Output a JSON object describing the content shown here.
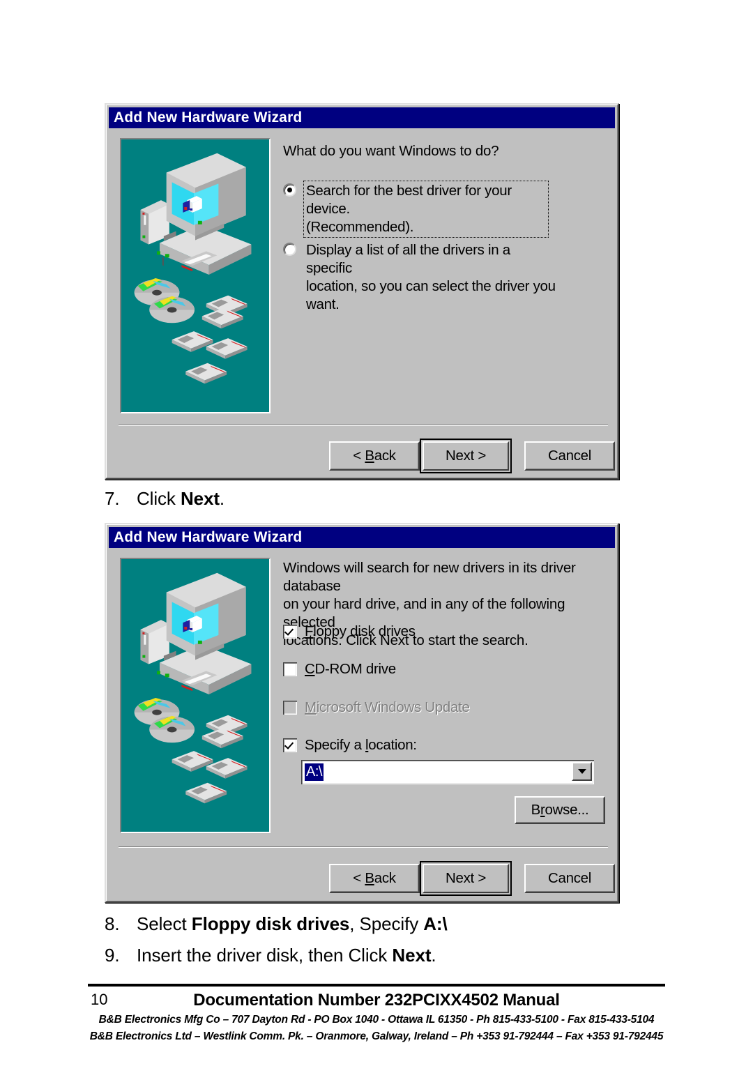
{
  "page": {
    "background": "#ffffff",
    "page_number": "10",
    "footer_title": "Documentation Number 232PCIXX4502 Manual",
    "footer_line_1": "B&B Electronics Mfg Co – 707 Dayton Rd - PO Box 1040 - Ottawa IL 61350 - Ph 815-433-5100 - Fax 815-433-5104",
    "footer_line_2": "B&B Electronics Ltd – Westlink Comm. Pk. – Oranmore, Galway, Ireland – Ph +353 91-792444 – Fax +353 91-792445"
  },
  "colors": {
    "titlebar": "#000080",
    "dialog_face": "#c0c0c0",
    "illustration_bg": "#008080",
    "selection": "#000080",
    "disabled_text": "#808080"
  },
  "dialog1": {
    "title": "Add New Hardware Wizard",
    "prompt": "What do you want Windows to do?",
    "options": [
      {
        "id": "search-best-driver",
        "line1": "Search for the best driver for your device.",
        "line2": "(Recommended).",
        "selected": true,
        "focused": true
      },
      {
        "id": "display-list-drivers",
        "line1": "Display a list of all the drivers in a specific",
        "line2": "location, so you can select the driver you want.",
        "selected": false,
        "focused": false
      }
    ],
    "buttons": {
      "back": "< Back",
      "back_pre": "< ",
      "back_mnemonic": "B",
      "back_post": "ack",
      "next": "Next >",
      "cancel": "Cancel"
    },
    "illustration": "computer-cds-floppies-illustration"
  },
  "step7": {
    "number": "7.",
    "text_pre": "Click ",
    "text_bold": "Next",
    "text_post": "."
  },
  "dialog2": {
    "title": "Add New Hardware Wizard",
    "prompt_line1": "Windows will search for new drivers in its driver database",
    "prompt_line2": "on your hard drive, and in any of the following selected",
    "prompt_line3": "locations. Click Next to start the search.",
    "checkboxes": [
      {
        "id": "floppy-disk-drives",
        "mnemonic": "F",
        "rest": "loppy disk drives",
        "pre": "",
        "checked": true,
        "disabled": false
      },
      {
        "id": "cd-rom-drive",
        "mnemonic": "C",
        "rest": "D-ROM drive",
        "pre": "",
        "checked": false,
        "disabled": false
      },
      {
        "id": "microsoft-windows-update",
        "mnemonic": "M",
        "rest": "icrosoft Windows Update",
        "pre": "",
        "checked": false,
        "disabled": true
      },
      {
        "id": "specify-a-location",
        "mnemonic": "l",
        "rest": "ocation:",
        "pre": "Specify a ",
        "checked": true,
        "disabled": false
      }
    ],
    "location_combo": {
      "value": "A:\\",
      "selected": true
    },
    "browse_button": {
      "pre": "B",
      "mnemonic": "r",
      "post": "owse..."
    },
    "buttons": {
      "back_pre": "< ",
      "back_mnemonic": "B",
      "back_post": "ack",
      "next": "Next >",
      "cancel": "Cancel"
    },
    "illustration": "computer-cds-floppies-illustration"
  },
  "step8": {
    "number": "8.",
    "t1": "Select ",
    "b1": "Floppy disk drives",
    "t2": ", Specify ",
    "b2": "A:\\"
  },
  "step9": {
    "number": "9.",
    "t1": "Insert the driver disk, then Click ",
    "b1": "Next",
    "t2": "."
  }
}
